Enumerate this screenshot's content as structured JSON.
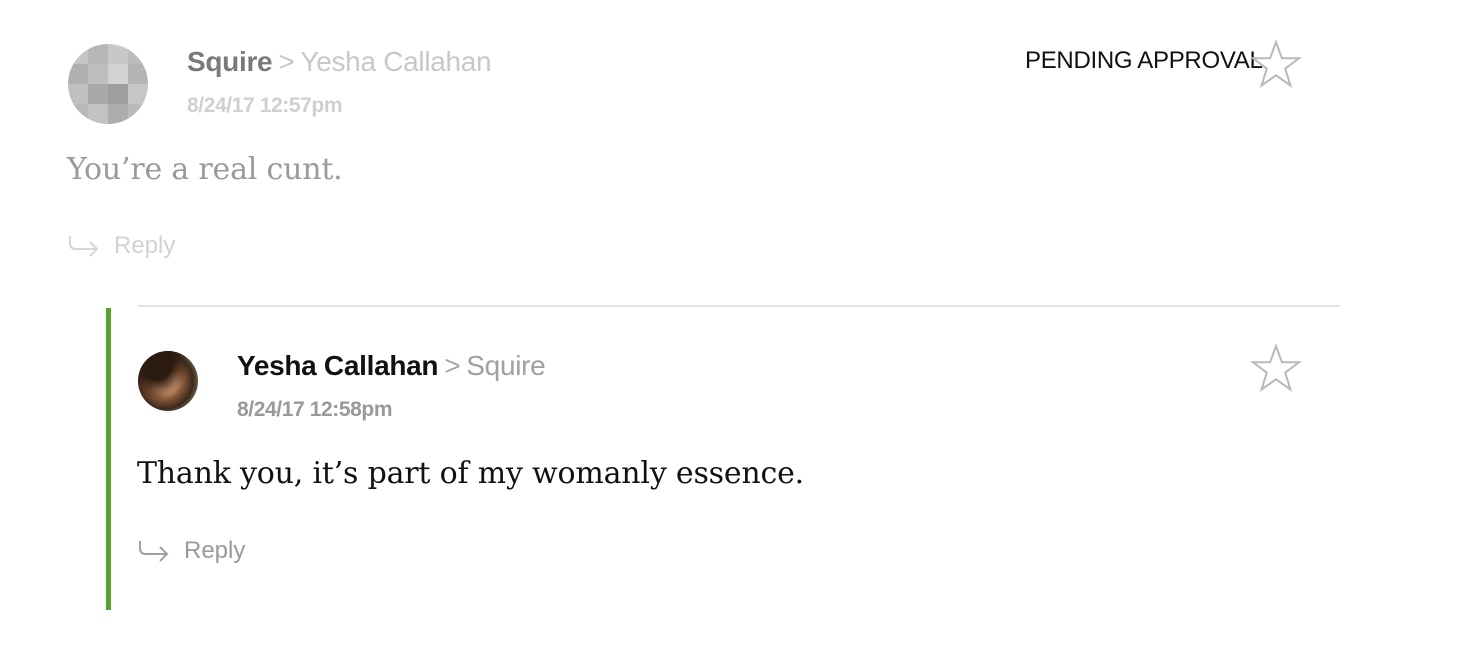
{
  "colors": {
    "thread_accent": "#55a32a",
    "star_outline": "#b8b8b8"
  },
  "comments": [
    {
      "author": "Squire",
      "separator": ">",
      "recipient": "Yesha Callahan",
      "timestamp": "8/24/17 12:57pm",
      "body": "You’re a real cunt.",
      "status": "PENDING APPROVAL",
      "reply_label": "Reply",
      "avatar_icon": "pixelated-avatar",
      "star_icon": "star-outline-icon"
    },
    {
      "author": "Yesha Callahan",
      "separator": ">",
      "recipient": "Squire",
      "timestamp": "8/24/17 12:58pm",
      "body": "Thank you, it’s part of my womanly essence.",
      "reply_label": "Reply",
      "avatar_icon": "user-photo-avatar",
      "star_icon": "star-outline-icon"
    }
  ]
}
